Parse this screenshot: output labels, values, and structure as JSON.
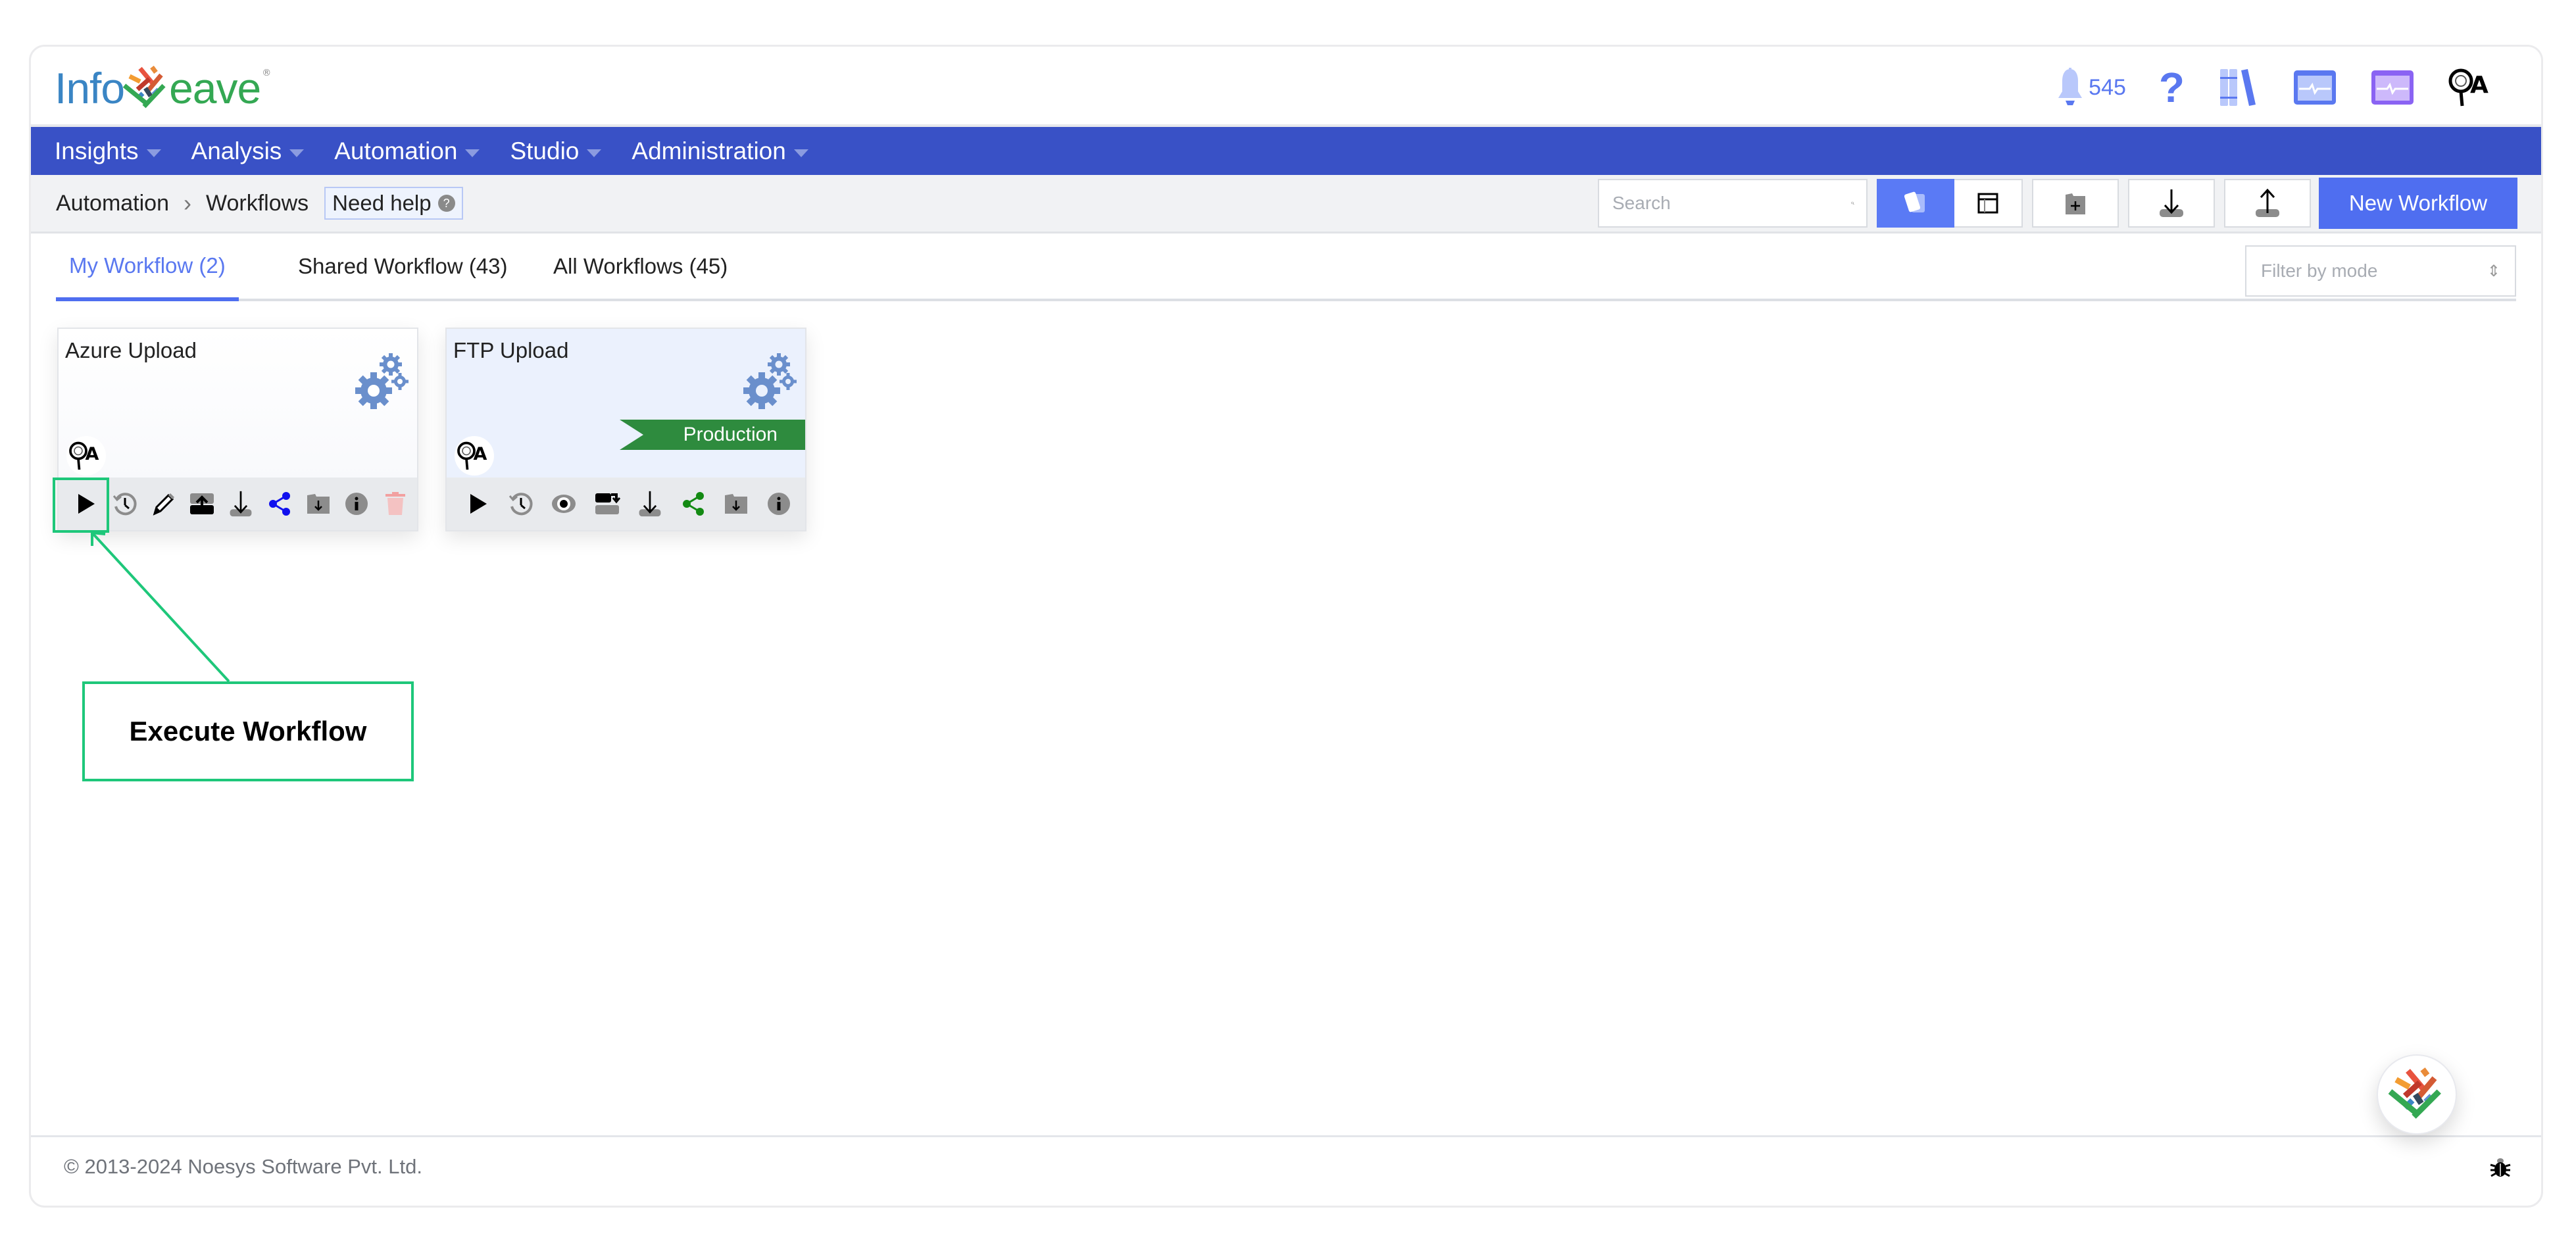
{
  "app": {
    "logo_left": "Info",
    "logo_right": "eave",
    "notifications_count": "545"
  },
  "header_icons": [
    {
      "name": "bell-icon",
      "label": "545"
    },
    {
      "name": "help-icon",
      "label": "?"
    },
    {
      "name": "library-icon"
    },
    {
      "name": "monitor-blue-icon"
    },
    {
      "name": "monitor-purple-icon"
    },
    {
      "name": "user-avatar-icon",
      "label": "QA"
    }
  ],
  "nav": {
    "items": [
      {
        "label": "Insights"
      },
      {
        "label": "Analysis"
      },
      {
        "label": "Automation"
      },
      {
        "label": "Studio"
      },
      {
        "label": "Administration"
      }
    ]
  },
  "breadcrumb": {
    "items": [
      "Automation",
      "Workflows"
    ],
    "separator": "›",
    "help_label": "Need help",
    "help_glyph": "?"
  },
  "toolbar": {
    "search_placeholder": "Search",
    "search_value": "",
    "view_buttons": [
      {
        "name": "card-view-icon",
        "active": true
      },
      {
        "name": "table-view-icon",
        "active": false
      }
    ],
    "buttons": [
      {
        "name": "new-folder-icon"
      },
      {
        "name": "import-icon"
      },
      {
        "name": "export-icon"
      }
    ],
    "new_label": "New Workflow"
  },
  "tabs": [
    {
      "label": "My Workflow (2)",
      "active": true
    },
    {
      "label": "Shared Workflow (43)",
      "active": false
    },
    {
      "label": "All Workflows (45)",
      "active": false
    }
  ],
  "filter": {
    "placeholder": "Filter by mode",
    "glyph": "⇕"
  },
  "workflows": [
    {
      "title": "Azure Upload",
      "owner": "QA",
      "badge": null,
      "actions": [
        "execute",
        "history",
        "edit",
        "publish",
        "download",
        "share",
        "move-to-folder",
        "info",
        "delete"
      ]
    },
    {
      "title": "FTP Upload",
      "owner": "QA",
      "badge": "Production",
      "actions": [
        "execute",
        "history",
        "view",
        "unpublish",
        "download",
        "share",
        "move-to-folder",
        "info"
      ]
    }
  ],
  "colors": {
    "nav": "#3951c6",
    "accent": "#4f6ef0",
    "production": "#2e8b3e",
    "annotation": "#1ec77a",
    "share_blue": "#1010ee",
    "share_green": "#138a13",
    "delete": "#f2b3b3"
  },
  "annotation": {
    "label": "Execute Workflow"
  },
  "footer": {
    "copyright": "© 2013-2024 Noesys Software Pvt. Ltd."
  }
}
